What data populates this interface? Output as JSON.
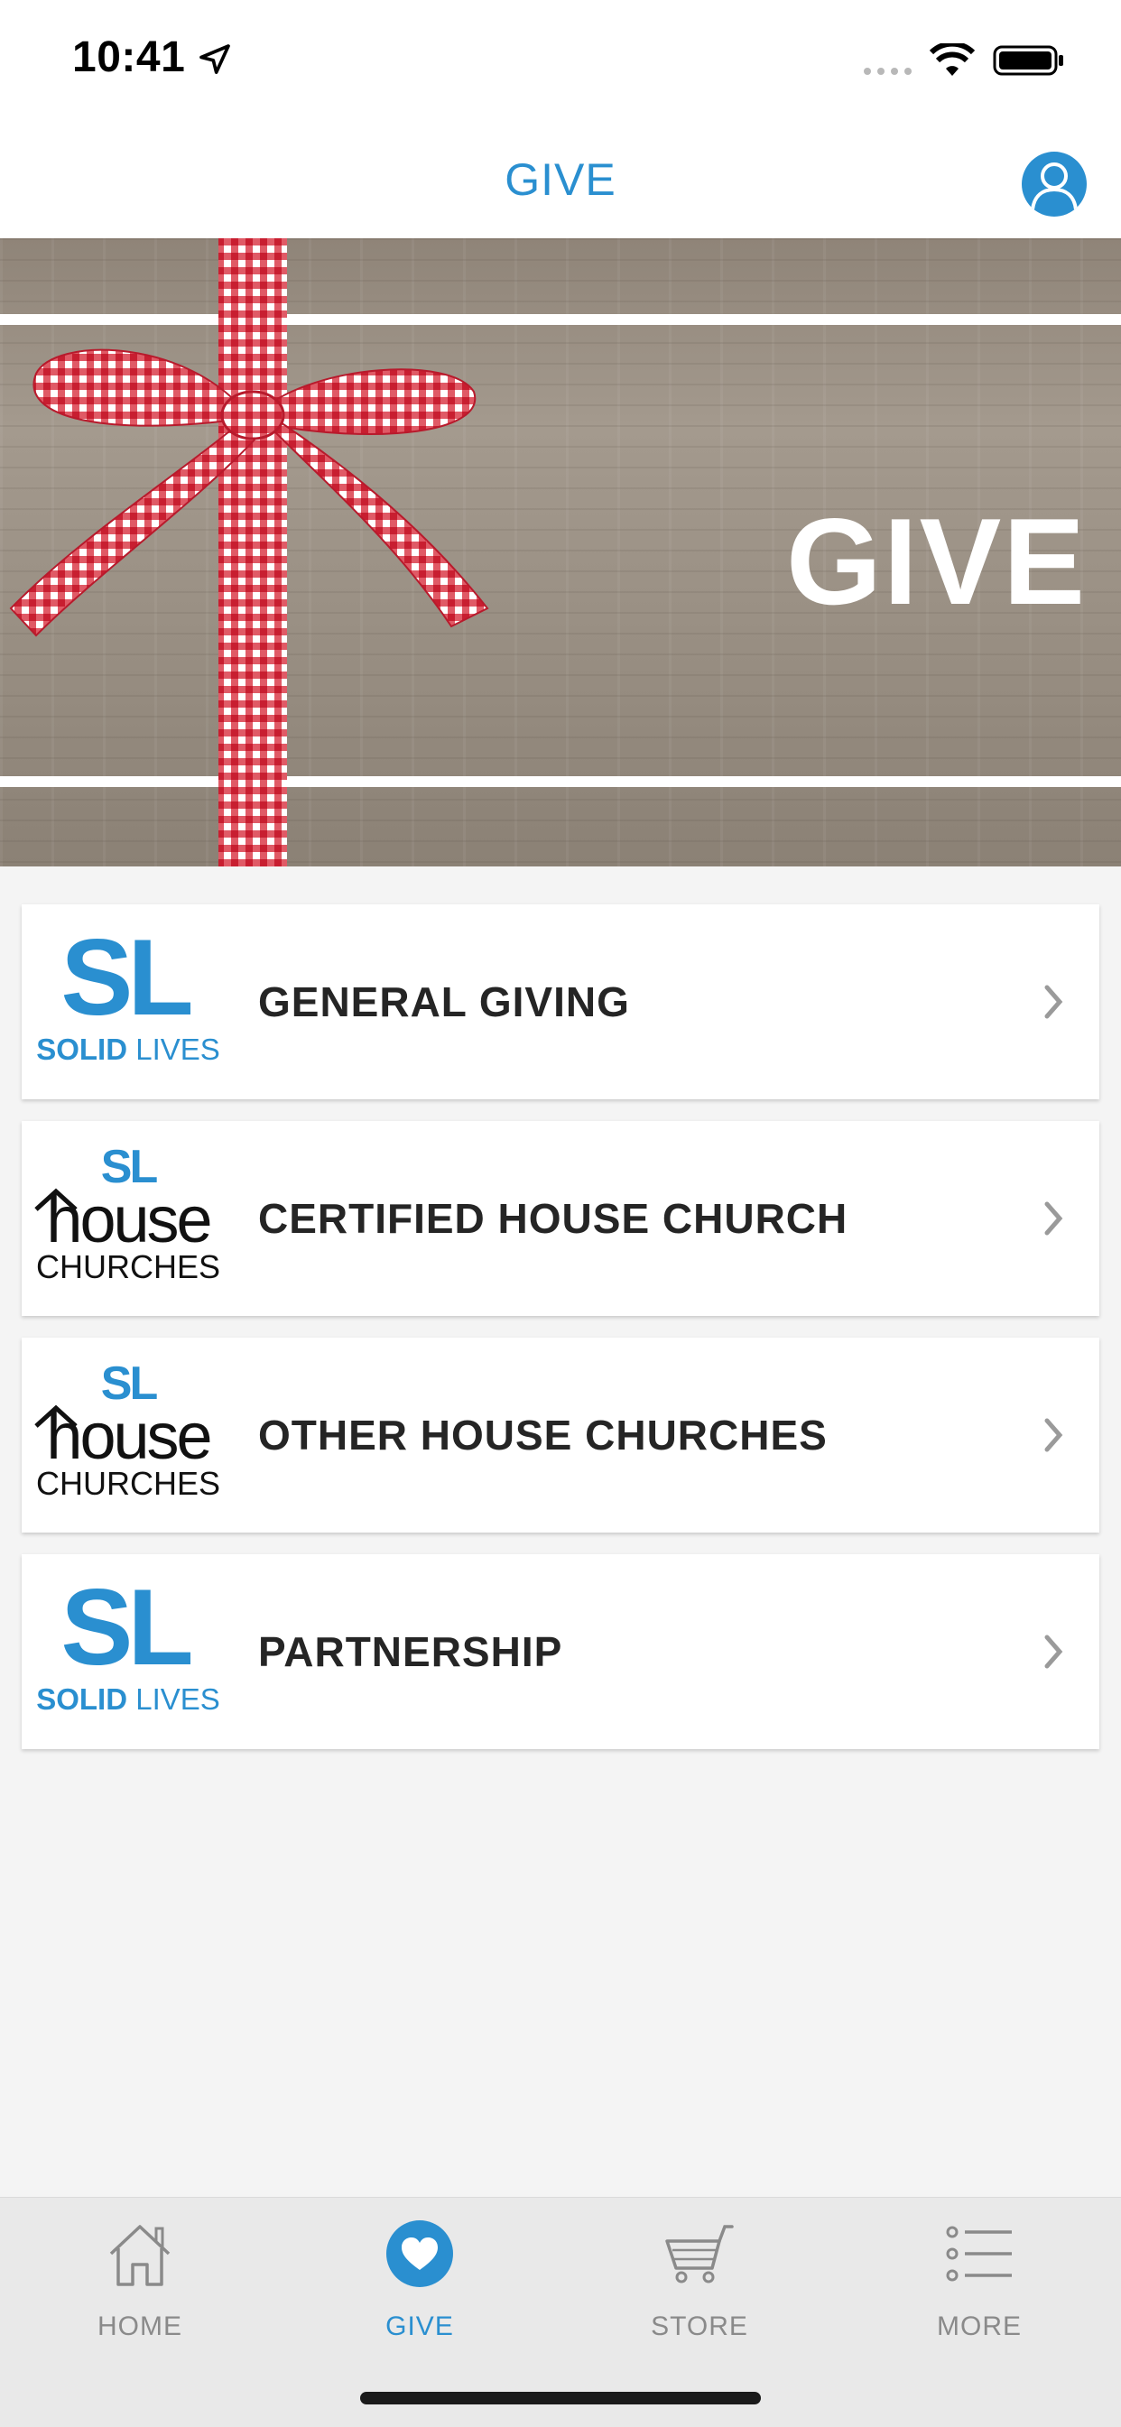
{
  "status_bar": {
    "time": "10:41"
  },
  "header": {
    "title": "GIVE",
    "profile_icon": "user-circle-icon"
  },
  "banner": {
    "title": "GIVE"
  },
  "giving_options": [
    {
      "label": "GENERAL GIVING",
      "logo": "solid-lives-logo",
      "logo_text": "SOLID LIVES"
    },
    {
      "label": "CERTIFIED HOUSE CHURCH",
      "logo": "house-churches-logo",
      "logo_text": "house CHURCHES"
    },
    {
      "label": "OTHER HOUSE CHURCHES",
      "logo": "house-churches-logo",
      "logo_text": "house CHURCHES"
    },
    {
      "label": "PARTNERSHIP",
      "logo": "solid-lives-logo",
      "logo_text": "SOLID LIVES"
    }
  ],
  "tabs": [
    {
      "label": "HOME",
      "icon": "home-icon",
      "active": false
    },
    {
      "label": "GIVE",
      "icon": "heart-icon",
      "active": true
    },
    {
      "label": "STORE",
      "icon": "cart-icon",
      "active": false
    },
    {
      "label": "MORE",
      "icon": "list-icon",
      "active": false
    }
  ],
  "colors": {
    "accent": "#2a8fd0",
    "tab_inactive": "#8a8a8a",
    "ribbon_red": "#d8283a"
  }
}
